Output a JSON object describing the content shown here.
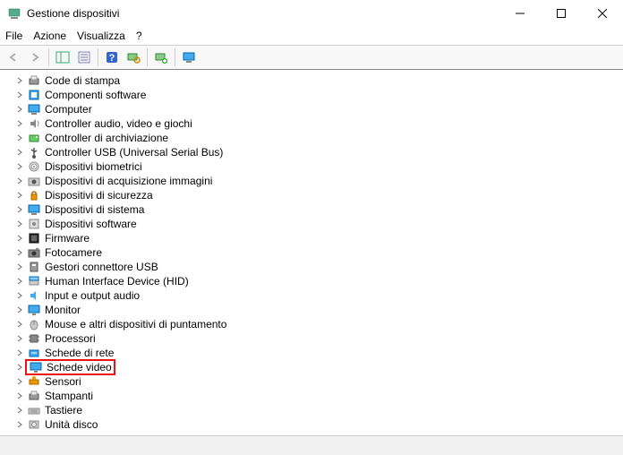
{
  "window": {
    "title": "Gestione dispositivi"
  },
  "menu": {
    "file": "File",
    "action": "Azione",
    "view": "Visualizza",
    "help": "?"
  },
  "tree": {
    "items": [
      {
        "label": "Code di stampa",
        "icon": "print-queue"
      },
      {
        "label": "Componenti software",
        "icon": "software"
      },
      {
        "label": "Computer",
        "icon": "computer"
      },
      {
        "label": "Controller audio, video e giochi",
        "icon": "audio"
      },
      {
        "label": "Controller di archiviazione",
        "icon": "storage"
      },
      {
        "label": "Controller USB (Universal Serial Bus)",
        "icon": "usb"
      },
      {
        "label": "Dispositivi biometrici",
        "icon": "biometric"
      },
      {
        "label": "Dispositivi di acquisizione immagini",
        "icon": "imaging"
      },
      {
        "label": "Dispositivi di sicurezza",
        "icon": "security"
      },
      {
        "label": "Dispositivi di sistema",
        "icon": "system"
      },
      {
        "label": "Dispositivi software",
        "icon": "softdev"
      },
      {
        "label": "Firmware",
        "icon": "firmware"
      },
      {
        "label": "Fotocamere",
        "icon": "camera"
      },
      {
        "label": "Gestori connettore USB",
        "icon": "usb-connector"
      },
      {
        "label": "Human Interface Device (HID)",
        "icon": "hid"
      },
      {
        "label": "Input e output audio",
        "icon": "audio-io"
      },
      {
        "label": "Monitor",
        "icon": "monitor"
      },
      {
        "label": "Mouse e altri dispositivi di puntamento",
        "icon": "mouse"
      },
      {
        "label": "Processori",
        "icon": "cpu"
      },
      {
        "label": "Schede di rete",
        "icon": "network"
      },
      {
        "label": "Schede video",
        "icon": "display",
        "highlight": true
      },
      {
        "label": "Sensori",
        "icon": "sensor"
      },
      {
        "label": "Stampanti",
        "icon": "printer"
      },
      {
        "label": "Tastiere",
        "icon": "keyboard"
      },
      {
        "label": "Unità disco",
        "icon": "disk"
      }
    ]
  }
}
